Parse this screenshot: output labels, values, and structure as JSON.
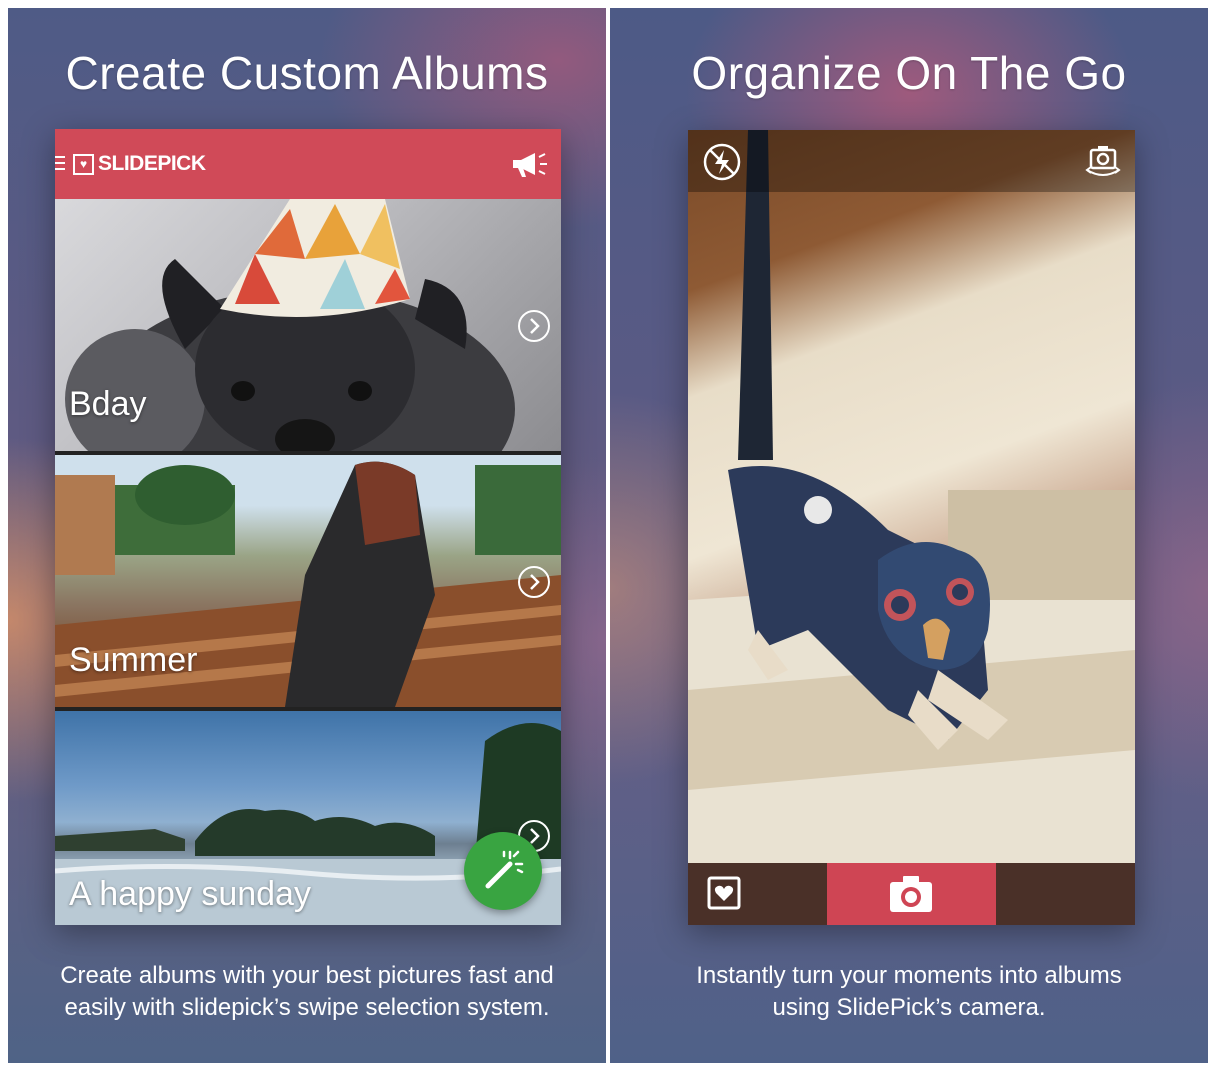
{
  "left_panel": {
    "headline": "Create Custom Albums",
    "caption_lines": [
      "Create albums with your best pictures fast and",
      "easily with slidepick’s swipe selection system."
    ],
    "app": {
      "brand": "SLIDEPICK",
      "brand_color": "#d04a58",
      "albums": [
        {
          "label": "Bday"
        },
        {
          "label": "Summer"
        },
        {
          "label": "A happy sunday"
        }
      ],
      "fab_color": "#39a441",
      "icons": [
        "menu-icon",
        "heart-logo-icon",
        "megaphone-icon",
        "chevron-right-icon",
        "magic-wand-icon"
      ]
    }
  },
  "right_panel": {
    "headline": "Organize On The Go",
    "caption_lines": [
      "Instantly turn your moments into albums",
      "using SlidePick’s camera."
    ],
    "camera": {
      "shutter_color": "#cf4554",
      "icons": [
        "flash-off-icon",
        "switch-camera-icon",
        "gallery-icon",
        "camera-icon"
      ]
    }
  }
}
